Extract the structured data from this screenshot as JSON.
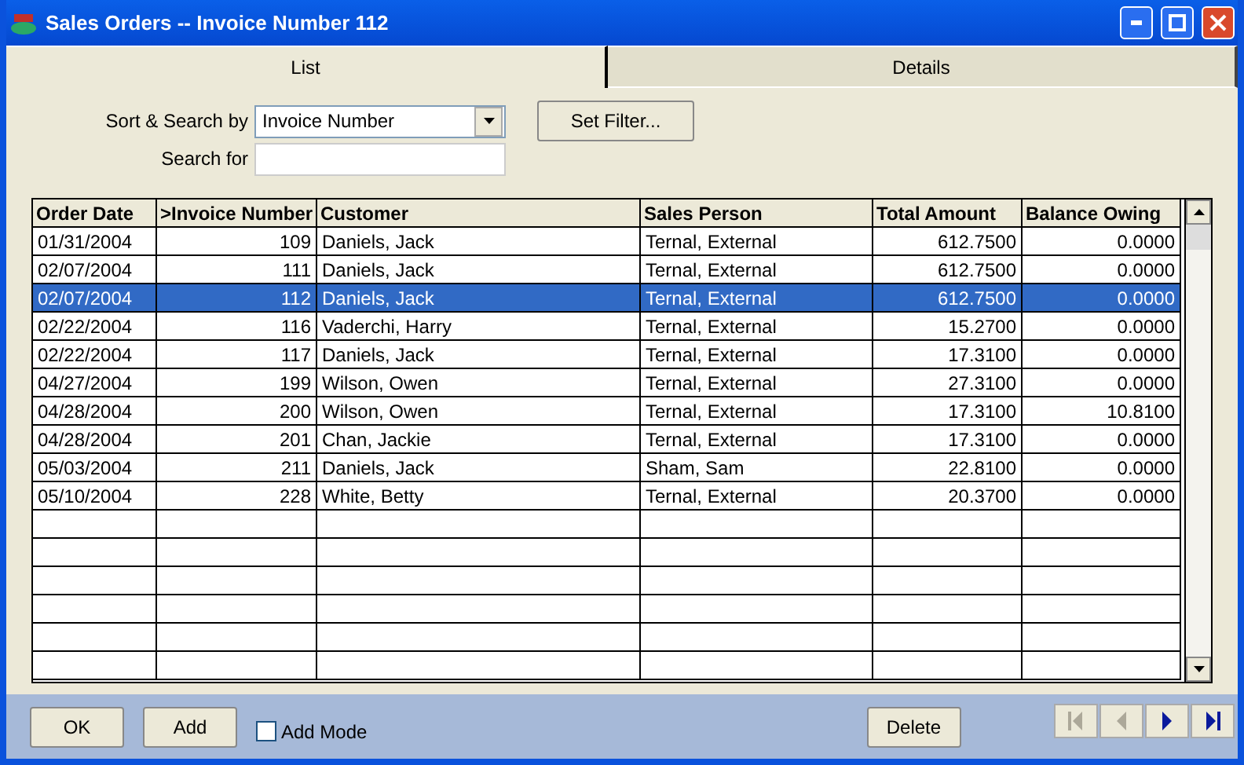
{
  "window": {
    "title": "Sales Orders -- Invoice Number 112"
  },
  "tabs": [
    {
      "label": "List",
      "selected": true
    },
    {
      "label": "Details",
      "selected": false
    }
  ],
  "sort_search_by": {
    "label": "Sort & Search by",
    "value": "Invoice Number"
  },
  "search_for": {
    "label": "Search for"
  },
  "set_filter_button": "Set Filter...",
  "table": {
    "columns": [
      "Order Date",
      ">Invoice Number",
      "Customer",
      "Sales Person",
      "Total Amount",
      "Balance Owing"
    ],
    "rows": [
      {
        "cells": [
          "01/31/2004",
          "109",
          "Daniels, Jack",
          "Ternal, External",
          "612.7500",
          "0.0000"
        ],
        "selected": false
      },
      {
        "cells": [
          "02/07/2004",
          "111",
          "Daniels, Jack",
          "Ternal, External",
          "612.7500",
          "0.0000"
        ],
        "selected": false
      },
      {
        "cells": [
          "02/07/2004",
          "112",
          "Daniels, Jack",
          "Ternal, External",
          "612.7500",
          "0.0000"
        ],
        "selected": true
      },
      {
        "cells": [
          "02/22/2004",
          "116",
          "Vaderchi, Harry",
          "Ternal, External",
          "15.2700",
          "0.0000"
        ],
        "selected": false
      },
      {
        "cells": [
          "02/22/2004",
          "117",
          "Daniels, Jack",
          "Ternal, External",
          "17.3100",
          "0.0000"
        ],
        "selected": false
      },
      {
        "cells": [
          "04/27/2004",
          "199",
          "Wilson, Owen",
          "Ternal, External",
          "27.3100",
          "0.0000"
        ],
        "selected": false
      },
      {
        "cells": [
          "04/28/2004",
          "200",
          "Wilson, Owen",
          "Ternal, External",
          "17.3100",
          "10.8100"
        ],
        "selected": false
      },
      {
        "cells": [
          "04/28/2004",
          "201",
          "Chan, Jackie",
          "Ternal, External",
          "17.3100",
          "0.0000"
        ],
        "selected": false
      },
      {
        "cells": [
          "05/03/2004",
          "211",
          "Daniels, Jack",
          "Sham, Sam",
          "22.8100",
          "0.0000"
        ],
        "selected": false
      },
      {
        "cells": [
          "05/10/2004",
          "228",
          "White, Betty",
          "Ternal, External",
          "20.3700",
          "0.0000"
        ],
        "selected": false
      }
    ]
  },
  "buttons": [
    "OK",
    "Add"
  ],
  "add_mode": {
    "label": "Add Mode",
    "checked": false
  },
  "delete_button": "Delete",
  "navigation": [
    {
      "kind": "first",
      "disabled": true
    },
    {
      "kind": "prev",
      "disabled": true
    },
    {
      "kind": "next",
      "disabled": false
    },
    {
      "kind": "last",
      "disabled": false
    }
  ]
}
